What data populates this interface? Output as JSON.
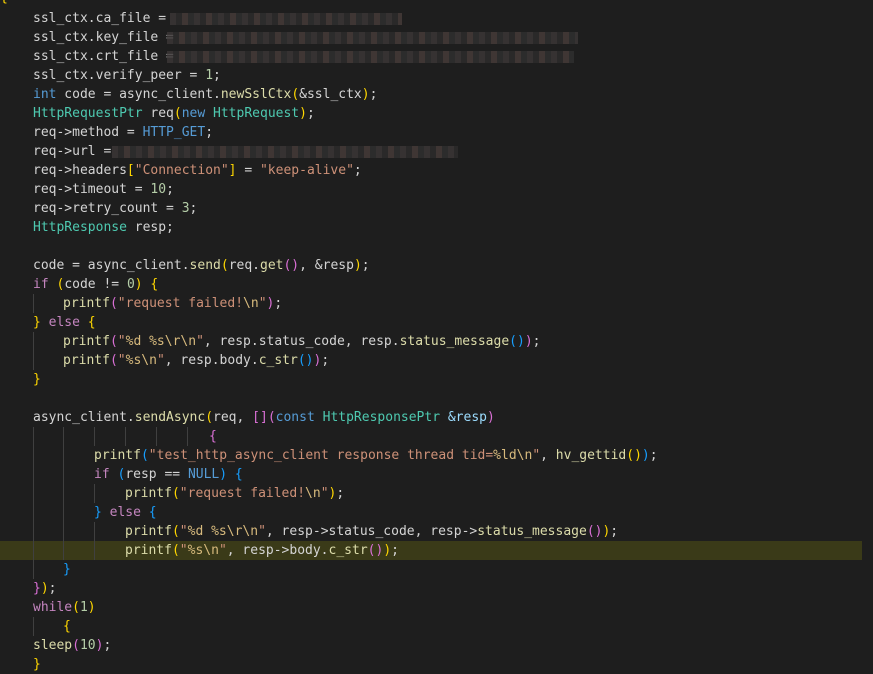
{
  "editor": {
    "theme": "dark",
    "colors": {
      "background": "#1e1e1e",
      "current_line": "#3a3a18",
      "keyword": "#569cd6",
      "control": "#c586c0",
      "type": "#4ec9b0",
      "function": "#dcdcaa",
      "string": "#ce9178",
      "number": "#b5cea8",
      "variable": "#9cdcfe"
    },
    "gutter_brace": "{"
  },
  "code": [
    {
      "tokens": [
        {
          "t": "ssl_ctx.ca_file = ",
          "c": "op"
        }
      ]
    },
    {
      "tokens": [
        {
          "t": "ssl_ctx.key_file = ",
          "c": "op"
        }
      ]
    },
    {
      "tokens": [
        {
          "t": "ssl_ctx.crt_file = ",
          "c": "op"
        }
      ]
    },
    {
      "tokens": [
        {
          "t": "ssl_ctx.verify_peer = ",
          "c": "op"
        },
        {
          "t": "1",
          "c": "nm"
        },
        {
          "t": ";",
          "c": "op"
        }
      ]
    },
    {
      "tokens": [
        {
          "t": "int",
          "c": "kw"
        },
        {
          "t": " code = async_client.",
          "c": "op"
        },
        {
          "t": "newSslCtx",
          "c": "fn"
        },
        {
          "t": "(",
          "c": "b1"
        },
        {
          "t": "&ssl_ctx",
          "c": "op"
        },
        {
          "t": ")",
          "c": "b1"
        },
        {
          "t": ";",
          "c": "op"
        }
      ]
    },
    {
      "tokens": [
        {
          "t": "HttpRequestPtr",
          "c": "ty"
        },
        {
          "t": " req",
          "c": "op"
        },
        {
          "t": "(",
          "c": "b1"
        },
        {
          "t": "new",
          "c": "kw"
        },
        {
          "t": " ",
          "c": "op"
        },
        {
          "t": "HttpRequest",
          "c": "ty"
        },
        {
          "t": ")",
          "c": "b1"
        },
        {
          "t": ";",
          "c": "op"
        }
      ]
    },
    {
      "tokens": [
        {
          "t": "req->method = ",
          "c": "op"
        },
        {
          "t": "HTTP_GET",
          "c": "mc"
        },
        {
          "t": ";",
          "c": "op"
        }
      ]
    },
    {
      "tokens": [
        {
          "t": "req->url = ",
          "c": "op"
        }
      ]
    },
    {
      "tokens": [
        {
          "t": "req->headers",
          "c": "op"
        },
        {
          "t": "[",
          "c": "b1"
        },
        {
          "t": "\"Connection\"",
          "c": "st"
        },
        {
          "t": "]",
          "c": "b1"
        },
        {
          "t": " = ",
          "c": "op"
        },
        {
          "t": "\"keep-alive\"",
          "c": "st"
        },
        {
          "t": ";",
          "c": "op"
        }
      ]
    },
    {
      "tokens": [
        {
          "t": "req->timeout = ",
          "c": "op"
        },
        {
          "t": "10",
          "c": "nm"
        },
        {
          "t": ";",
          "c": "op"
        }
      ]
    },
    {
      "tokens": [
        {
          "t": "req->retry_count = ",
          "c": "op"
        },
        {
          "t": "3",
          "c": "nm"
        },
        {
          "t": ";",
          "c": "op"
        }
      ]
    },
    {
      "tokens": [
        {
          "t": "HttpResponse",
          "c": "ty"
        },
        {
          "t": " resp;",
          "c": "op"
        }
      ]
    },
    {
      "tokens": []
    },
    {
      "tokens": [
        {
          "t": "code = async_client.",
          "c": "op"
        },
        {
          "t": "send",
          "c": "fn"
        },
        {
          "t": "(",
          "c": "b1"
        },
        {
          "t": "req.",
          "c": "op"
        },
        {
          "t": "get",
          "c": "fn"
        },
        {
          "t": "()",
          "c": "b2"
        },
        {
          "t": ", &resp",
          "c": "op"
        },
        {
          "t": ")",
          "c": "b1"
        },
        {
          "t": ";",
          "c": "op"
        }
      ]
    },
    {
      "tokens": [
        {
          "t": "if",
          "c": "cf"
        },
        {
          "t": " ",
          "c": "op"
        },
        {
          "t": "(",
          "c": "b1"
        },
        {
          "t": "code != ",
          "c": "op"
        },
        {
          "t": "0",
          "c": "nm"
        },
        {
          "t": ")",
          "c": "b1"
        },
        {
          "t": " ",
          "c": "op"
        },
        {
          "t": "{",
          "c": "b1"
        }
      ]
    },
    {
      "tokens": [
        {
          "t": "printf",
          "c": "fn"
        },
        {
          "t": "(",
          "c": "b2"
        },
        {
          "t": "\"request failed!",
          "c": "st"
        },
        {
          "t": "\\n",
          "c": "es"
        },
        {
          "t": "\"",
          "c": "st"
        },
        {
          "t": ")",
          "c": "b2"
        },
        {
          "t": ";",
          "c": "op"
        }
      ]
    },
    {
      "tokens": [
        {
          "t": "}",
          "c": "b1"
        },
        {
          "t": " ",
          "c": "op"
        },
        {
          "t": "else",
          "c": "cf"
        },
        {
          "t": " ",
          "c": "op"
        },
        {
          "t": "{",
          "c": "b1"
        }
      ]
    },
    {
      "tokens": [
        {
          "t": "printf",
          "c": "fn"
        },
        {
          "t": "(",
          "c": "b2"
        },
        {
          "t": "\"",
          "c": "st"
        },
        {
          "t": "%d",
          "c": "es"
        },
        {
          "t": " ",
          "c": "st"
        },
        {
          "t": "%s\\r\\n",
          "c": "es"
        },
        {
          "t": "\"",
          "c": "st"
        },
        {
          "t": ", resp.status_code, resp.",
          "c": "op"
        },
        {
          "t": "status_message",
          "c": "fn"
        },
        {
          "t": "()",
          "c": "b3"
        },
        {
          "t": ")",
          "c": "b2"
        },
        {
          "t": ";",
          "c": "op"
        }
      ]
    },
    {
      "tokens": [
        {
          "t": "printf",
          "c": "fn"
        },
        {
          "t": "(",
          "c": "b2"
        },
        {
          "t": "\"",
          "c": "st"
        },
        {
          "t": "%s\\n",
          "c": "es"
        },
        {
          "t": "\"",
          "c": "st"
        },
        {
          "t": ", resp.body.",
          "c": "op"
        },
        {
          "t": "c_str",
          "c": "fn"
        },
        {
          "t": "()",
          "c": "b3"
        },
        {
          "t": ")",
          "c": "b2"
        },
        {
          "t": ";",
          "c": "op"
        }
      ]
    },
    {
      "tokens": [
        {
          "t": "}",
          "c": "b1"
        }
      ]
    },
    {
      "tokens": []
    },
    {
      "tokens": [
        {
          "t": "async_client.",
          "c": "op"
        },
        {
          "t": "sendAsync",
          "c": "fn"
        },
        {
          "t": "(",
          "c": "b1"
        },
        {
          "t": "req, ",
          "c": "op"
        },
        {
          "t": "[]",
          "c": "b2"
        },
        {
          "t": "(",
          "c": "b2"
        },
        {
          "t": "const",
          "c": "kw"
        },
        {
          "t": " ",
          "c": "op"
        },
        {
          "t": "HttpResponsePtr",
          "c": "ty"
        },
        {
          "t": " ",
          "c": "op"
        },
        {
          "t": "&resp",
          "c": "vr"
        },
        {
          "t": ")",
          "c": "b2"
        }
      ]
    },
    {
      "tokens": [
        {
          "t": "{",
          "c": "b2"
        }
      ]
    },
    {
      "tokens": [
        {
          "t": "printf",
          "c": "fn"
        },
        {
          "t": "(",
          "c": "b3"
        },
        {
          "t": "\"test_http_async_client response thread tid=",
          "c": "st"
        },
        {
          "t": "%ld\\n",
          "c": "es"
        },
        {
          "t": "\"",
          "c": "st"
        },
        {
          "t": ", ",
          "c": "op"
        },
        {
          "t": "hv_gettid",
          "c": "fn"
        },
        {
          "t": "()",
          "c": "b1"
        },
        {
          "t": ")",
          "c": "b3"
        },
        {
          "t": ";",
          "c": "op"
        }
      ]
    },
    {
      "tokens": [
        {
          "t": "if",
          "c": "cf"
        },
        {
          "t": " ",
          "c": "op"
        },
        {
          "t": "(",
          "c": "b3"
        },
        {
          "t": "resp == ",
          "c": "op"
        },
        {
          "t": "NULL",
          "c": "kw"
        },
        {
          "t": ")",
          "c": "b3"
        },
        {
          "t": " ",
          "c": "op"
        },
        {
          "t": "{",
          "c": "b3"
        }
      ]
    },
    {
      "tokens": [
        {
          "t": "printf",
          "c": "fn"
        },
        {
          "t": "(",
          "c": "b1"
        },
        {
          "t": "\"request failed!",
          "c": "st"
        },
        {
          "t": "\\n",
          "c": "es"
        },
        {
          "t": "\"",
          "c": "st"
        },
        {
          "t": ")",
          "c": "b1"
        },
        {
          "t": ";",
          "c": "op"
        }
      ]
    },
    {
      "tokens": [
        {
          "t": "}",
          "c": "b3"
        },
        {
          "t": " ",
          "c": "op"
        },
        {
          "t": "else",
          "c": "cf"
        },
        {
          "t": " ",
          "c": "op"
        },
        {
          "t": "{",
          "c": "b3"
        }
      ]
    },
    {
      "tokens": [
        {
          "t": "printf",
          "c": "fn"
        },
        {
          "t": "(",
          "c": "b1"
        },
        {
          "t": "\"",
          "c": "st"
        },
        {
          "t": "%d",
          "c": "es"
        },
        {
          "t": " ",
          "c": "st"
        },
        {
          "t": "%s\\r\\n",
          "c": "es"
        },
        {
          "t": "\"",
          "c": "st"
        },
        {
          "t": ", resp->status_code, resp->",
          "c": "op"
        },
        {
          "t": "status_message",
          "c": "fn"
        },
        {
          "t": "()",
          "c": "b2"
        },
        {
          "t": ")",
          "c": "b1"
        },
        {
          "t": ";",
          "c": "op"
        }
      ]
    },
    {
      "tokens": [
        {
          "t": "printf",
          "c": "fn"
        },
        {
          "t": "(",
          "c": "b1"
        },
        {
          "t": "\"",
          "c": "st"
        },
        {
          "t": "%s\\n",
          "c": "es"
        },
        {
          "t": "\"",
          "c": "st"
        },
        {
          "t": ", resp->body.",
          "c": "op"
        },
        {
          "t": "c_str",
          "c": "fn"
        },
        {
          "t": "()",
          "c": "b2"
        },
        {
          "t": ")",
          "c": "b1"
        },
        {
          "t": ";",
          "c": "op"
        }
      ]
    },
    {
      "tokens": [
        {
          "t": "}",
          "c": "b3"
        }
      ]
    },
    {
      "tokens": [
        {
          "t": "}",
          "c": "b2"
        },
        {
          "t": ")",
          "c": "b1"
        },
        {
          "t": ";",
          "c": "op"
        }
      ]
    },
    {
      "tokens": [
        {
          "t": "while",
          "c": "cf"
        },
        {
          "t": "(",
          "c": "b1"
        },
        {
          "t": "1",
          "c": "nm"
        },
        {
          "t": ")",
          "c": "b1"
        }
      ]
    },
    {
      "tokens": [
        {
          "t": "{",
          "c": "b1"
        }
      ]
    },
    {
      "tokens": [
        {
          "t": "sleep",
          "c": "fn"
        },
        {
          "t": "(",
          "c": "b2"
        },
        {
          "t": "10",
          "c": "nm"
        },
        {
          "t": ")",
          "c": "b2"
        },
        {
          "t": ";",
          "c": "op"
        }
      ]
    },
    {
      "tokens": [
        {
          "t": "}",
          "c": "b1"
        }
      ]
    }
  ]
}
